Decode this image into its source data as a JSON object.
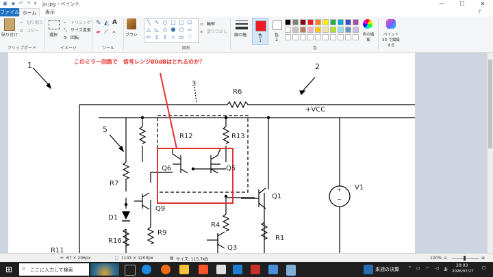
{
  "window": {
    "title": "jp.jpg - ペイント"
  },
  "menu": {
    "file": "ファイル",
    "home": "ホーム",
    "view": "表示"
  },
  "clipboard": {
    "paste": "貼り付け",
    "cut": "切り取り",
    "copy": "コピー",
    "group": "クリップボード"
  },
  "image": {
    "select": "選択",
    "crop": "トリミング",
    "resize": "サイズ変更",
    "rotate": "回転",
    "group": "イメージ"
  },
  "tools": {
    "group": "ツール",
    "letter_a": "A"
  },
  "brush": {
    "label": "ブラシ"
  },
  "shapes": {
    "outline": "輪郭",
    "fill": "塗りつぶし",
    "group": "図形"
  },
  "size": {
    "label": "線の幅"
  },
  "colors": {
    "color1": "色\n1",
    "color2": "色\n2",
    "edit": "色の編集",
    "group": "色",
    "palette": [
      "#000000",
      "#7f7f7f",
      "#880015",
      "#ed1c24",
      "#ff7f27",
      "#fff200",
      "#22b14c",
      "#00a2e8",
      "#3f48cc",
      "#a349a4",
      "#ffffff",
      "#c3c3c3",
      "#b97a57",
      "#ffaec9",
      "#ffc90e",
      "#efe4b0",
      "#b5e61d",
      "#99d9ea",
      "#7092be",
      "#c8bfe7"
    ],
    "accent_red": "#ed1c24"
  },
  "paint3d": {
    "label": "ペイント 3D で編集する"
  },
  "drawing": {
    "annotation": "このミラー回路で　信号レンジ80dBはとれるのか？",
    "labels": {
      "n1": "1",
      "n2": "2",
      "n3": "3",
      "n5": "5",
      "R6": "R6",
      "VCC": "+VCC",
      "R12": "R12",
      "R13": "R13",
      "Q6": "Q6",
      "Q5": "Q5",
      "R7": "R7",
      "V1": "V1",
      "Q1": "Q1",
      "Q9": "Q9",
      "D1": "D1",
      "R4": "R4",
      "R9": "R9",
      "R16": "R16",
      "R1": "R1",
      "Q3": "Q3",
      "R11": "R11",
      "plus": "+",
      "minus": "−"
    }
  },
  "status": {
    "pos": "67 × 206px",
    "dims": "1143 × 1200px",
    "size": "サイズ: 115.7KB",
    "zoom": "100%"
  },
  "taskbar": {
    "search_placeholder": "ここに入力して検索",
    "news": "来週の決算",
    "time": "20:03",
    "date": "2026/07/27"
  }
}
